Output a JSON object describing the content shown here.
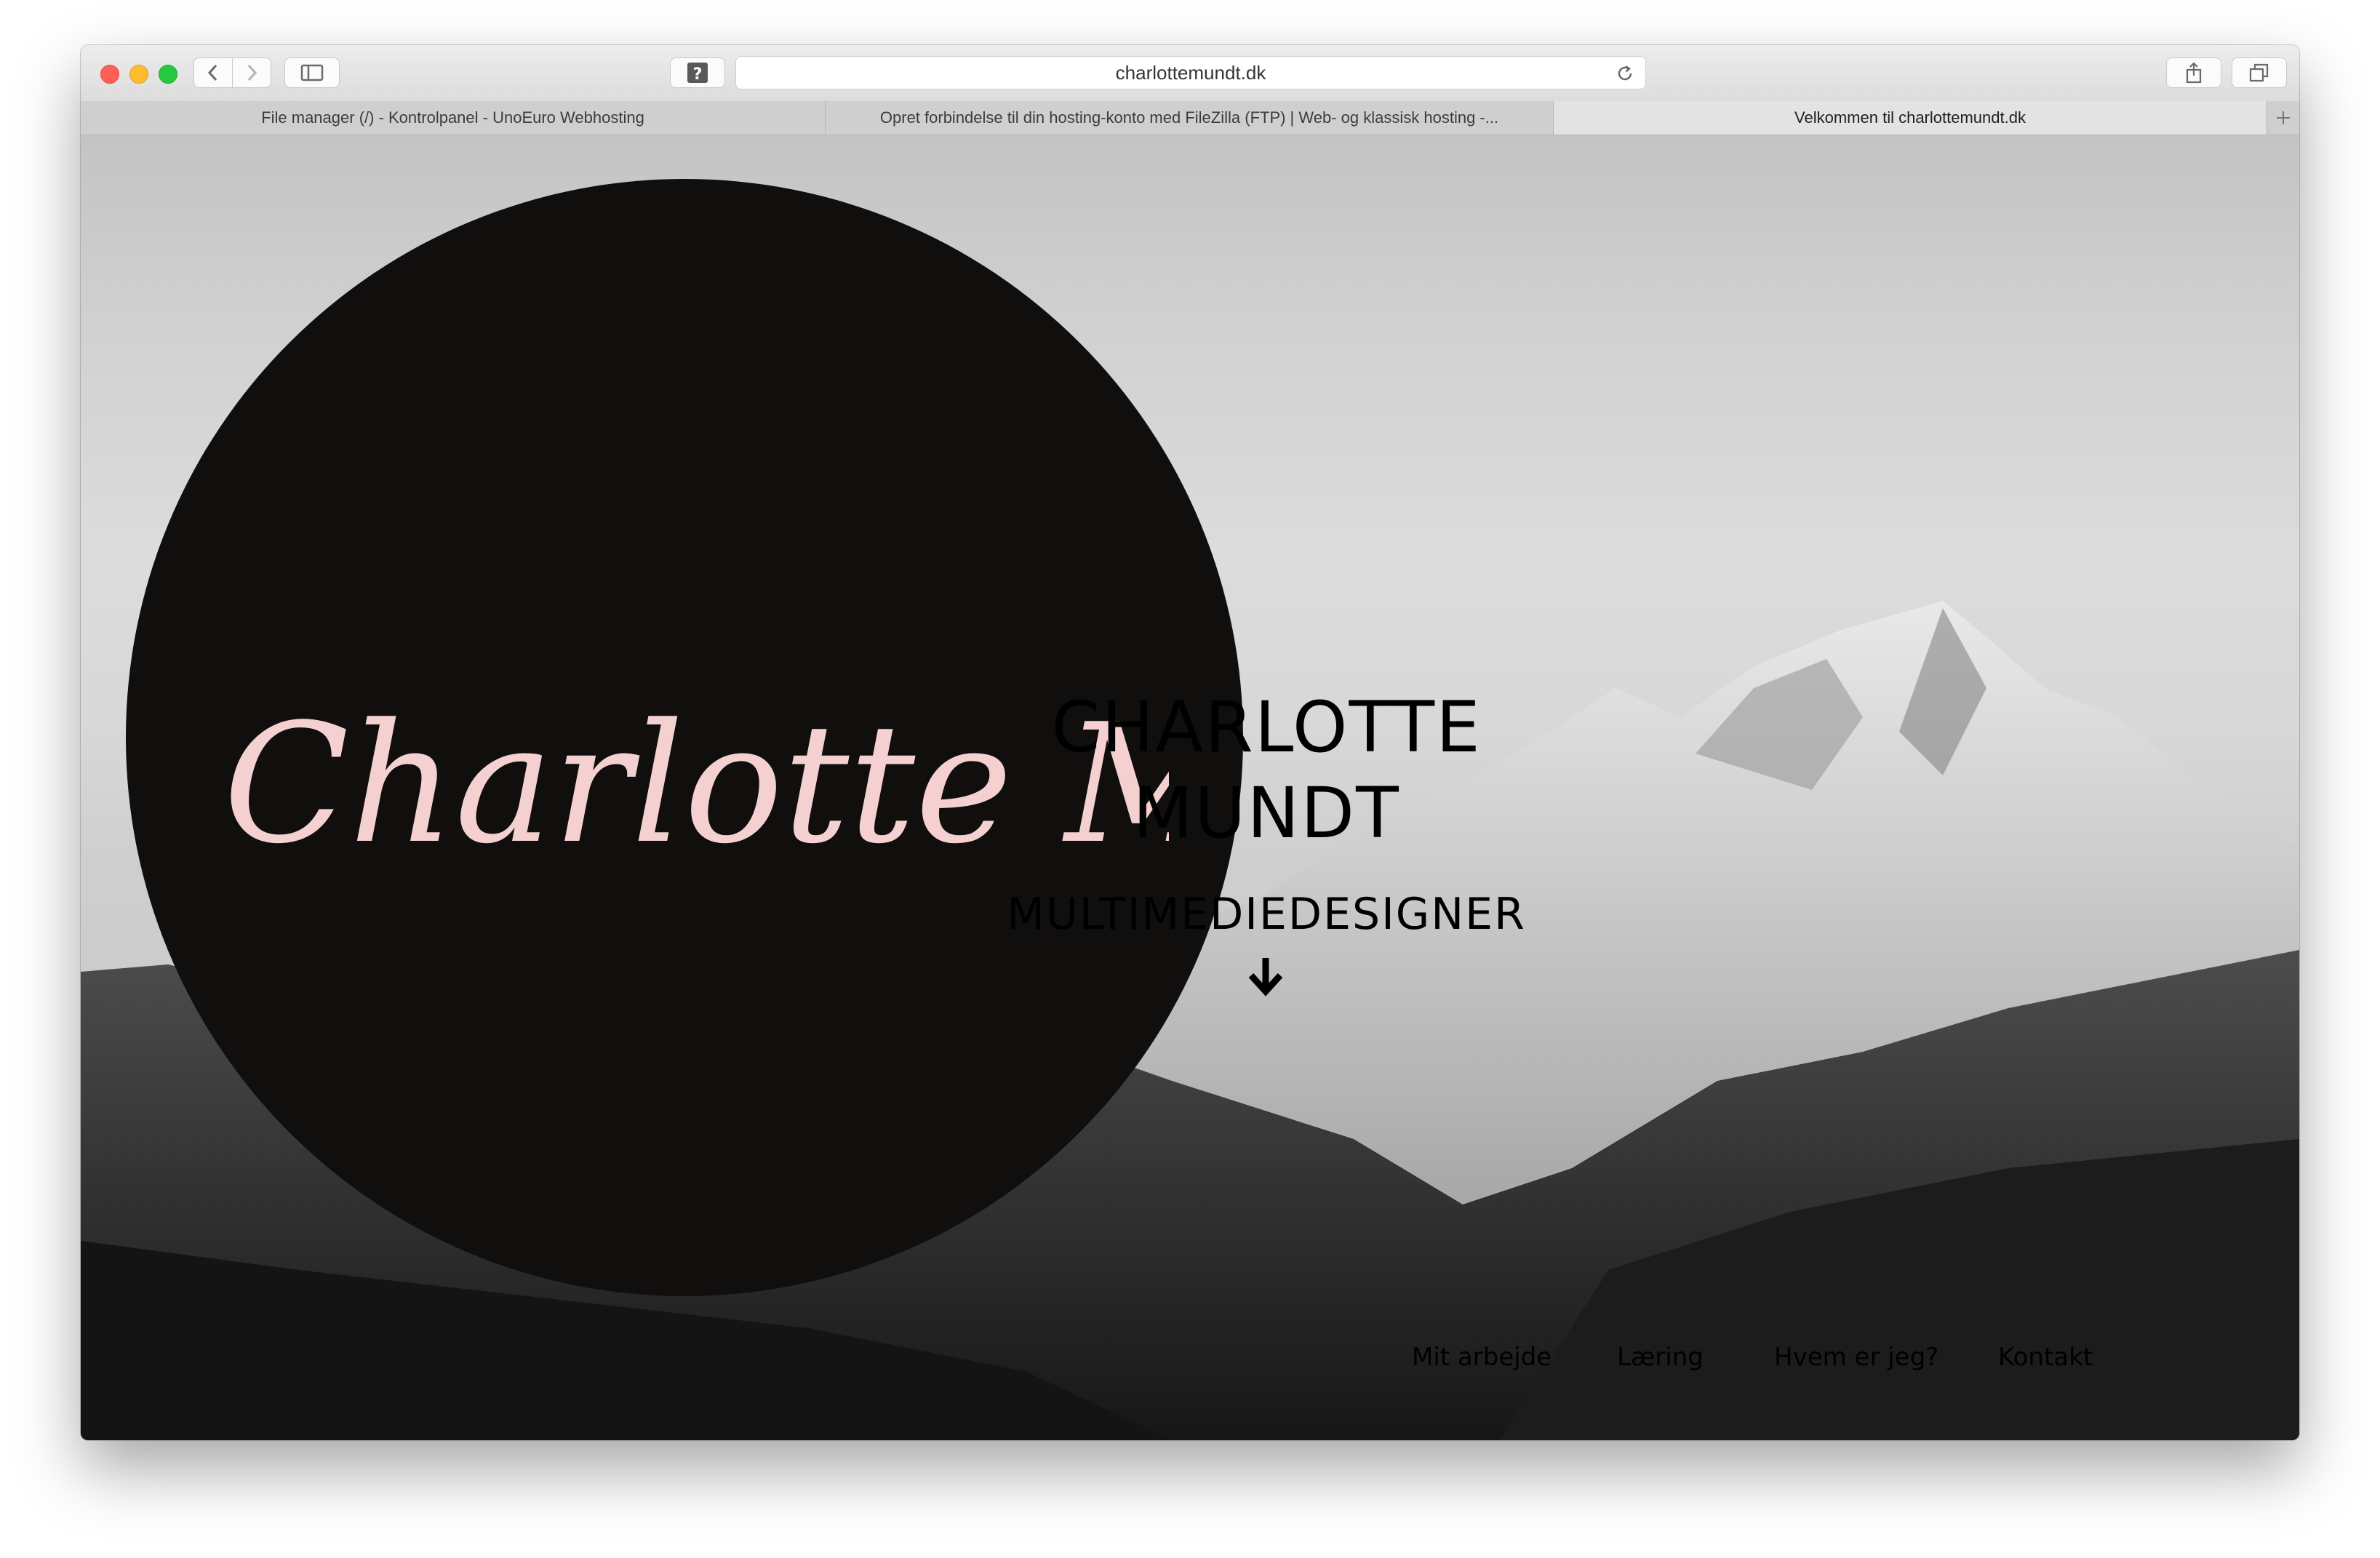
{
  "browser": {
    "url": "charlottemundt.dk",
    "tabs": [
      {
        "title": "File manager (/) - Kontrolpanel - UnoEuro Webhosting"
      },
      {
        "title": "Opret forbindelse til din hosting-konto med FileZilla (FTP) | Web- og klassisk hosting -..."
      },
      {
        "title": "Velkommen til charlottemundt.dk",
        "active": true
      }
    ],
    "icons": {
      "back": "chevron-left-icon",
      "forward": "chevron-right-icon",
      "sidebar": "sidebar-icon",
      "help": "question-mark-icon",
      "reload": "reload-icon",
      "share": "share-icon",
      "tabs": "tabs-overview-icon",
      "new_tab": "plus-icon"
    }
  },
  "site": {
    "logo_text": "Charlotte Mundt",
    "logo_color": "#f5d0d0",
    "circle_color": "#110e0e",
    "hero_title_line1": "CHARLOTTE",
    "hero_title_line2": "MUNDT",
    "hero_subtitle": "MULTIMEDIEDESIGNER",
    "scroll_icon": "arrow-down-icon",
    "menu": [
      {
        "label": "Mit arbejde"
      },
      {
        "label": "Læring"
      },
      {
        "label": "Hvem er jeg?"
      },
      {
        "label": "Kontakt"
      }
    ]
  }
}
